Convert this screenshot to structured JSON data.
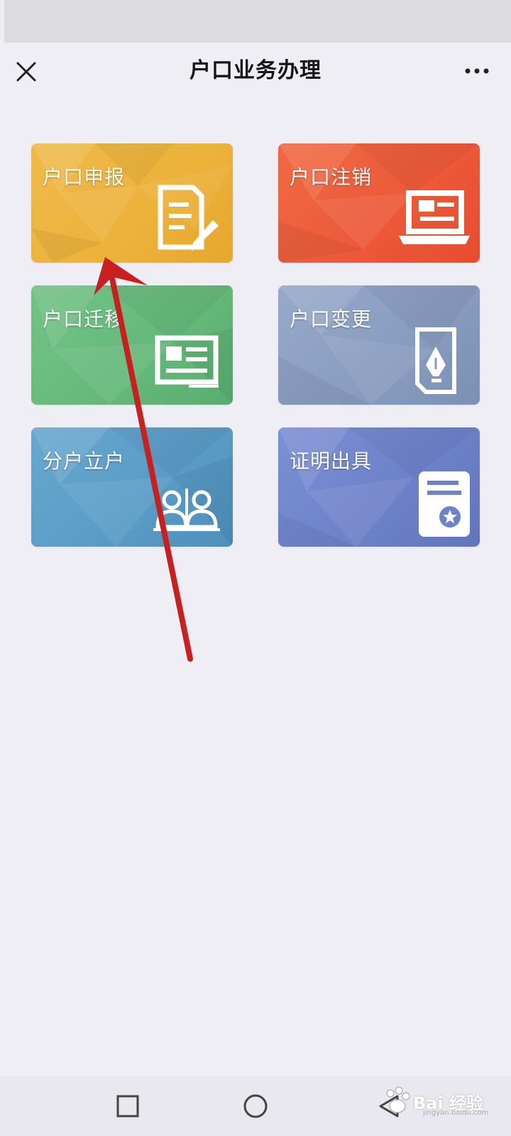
{
  "header": {
    "title": "户口业务办理",
    "close_icon": "close-icon",
    "more_icon": "more-icon"
  },
  "tiles": [
    {
      "label": "户口申报",
      "icon": "document-edit-icon",
      "color": "#ecb33b"
    },
    {
      "label": "户口注销",
      "icon": "computer-monitor-icon",
      "color": "#ec5a39"
    },
    {
      "label": "户口迁移",
      "icon": "notice-board-icon",
      "color": "#66b97b"
    },
    {
      "label": "户口变更",
      "icon": "pen-nib-document-icon",
      "color": "#899dc0"
    },
    {
      "label": "分户立户",
      "icon": "two-people-icon",
      "color": "#5b9cc6"
    },
    {
      "label": "证明出具",
      "icon": "certificate-icon",
      "color": "#6e82c9"
    }
  ],
  "annotation": {
    "arrow_color": "#c8201f",
    "arrow_icon": "red-arrow-annotation"
  },
  "system_nav": {
    "recent_icon": "square-recent-icon",
    "home_icon": "circle-home-icon",
    "back_icon": "triangle-back-icon"
  },
  "watermark": {
    "text": "Bai 经验",
    "sub": "jingyan.baidu.com"
  }
}
